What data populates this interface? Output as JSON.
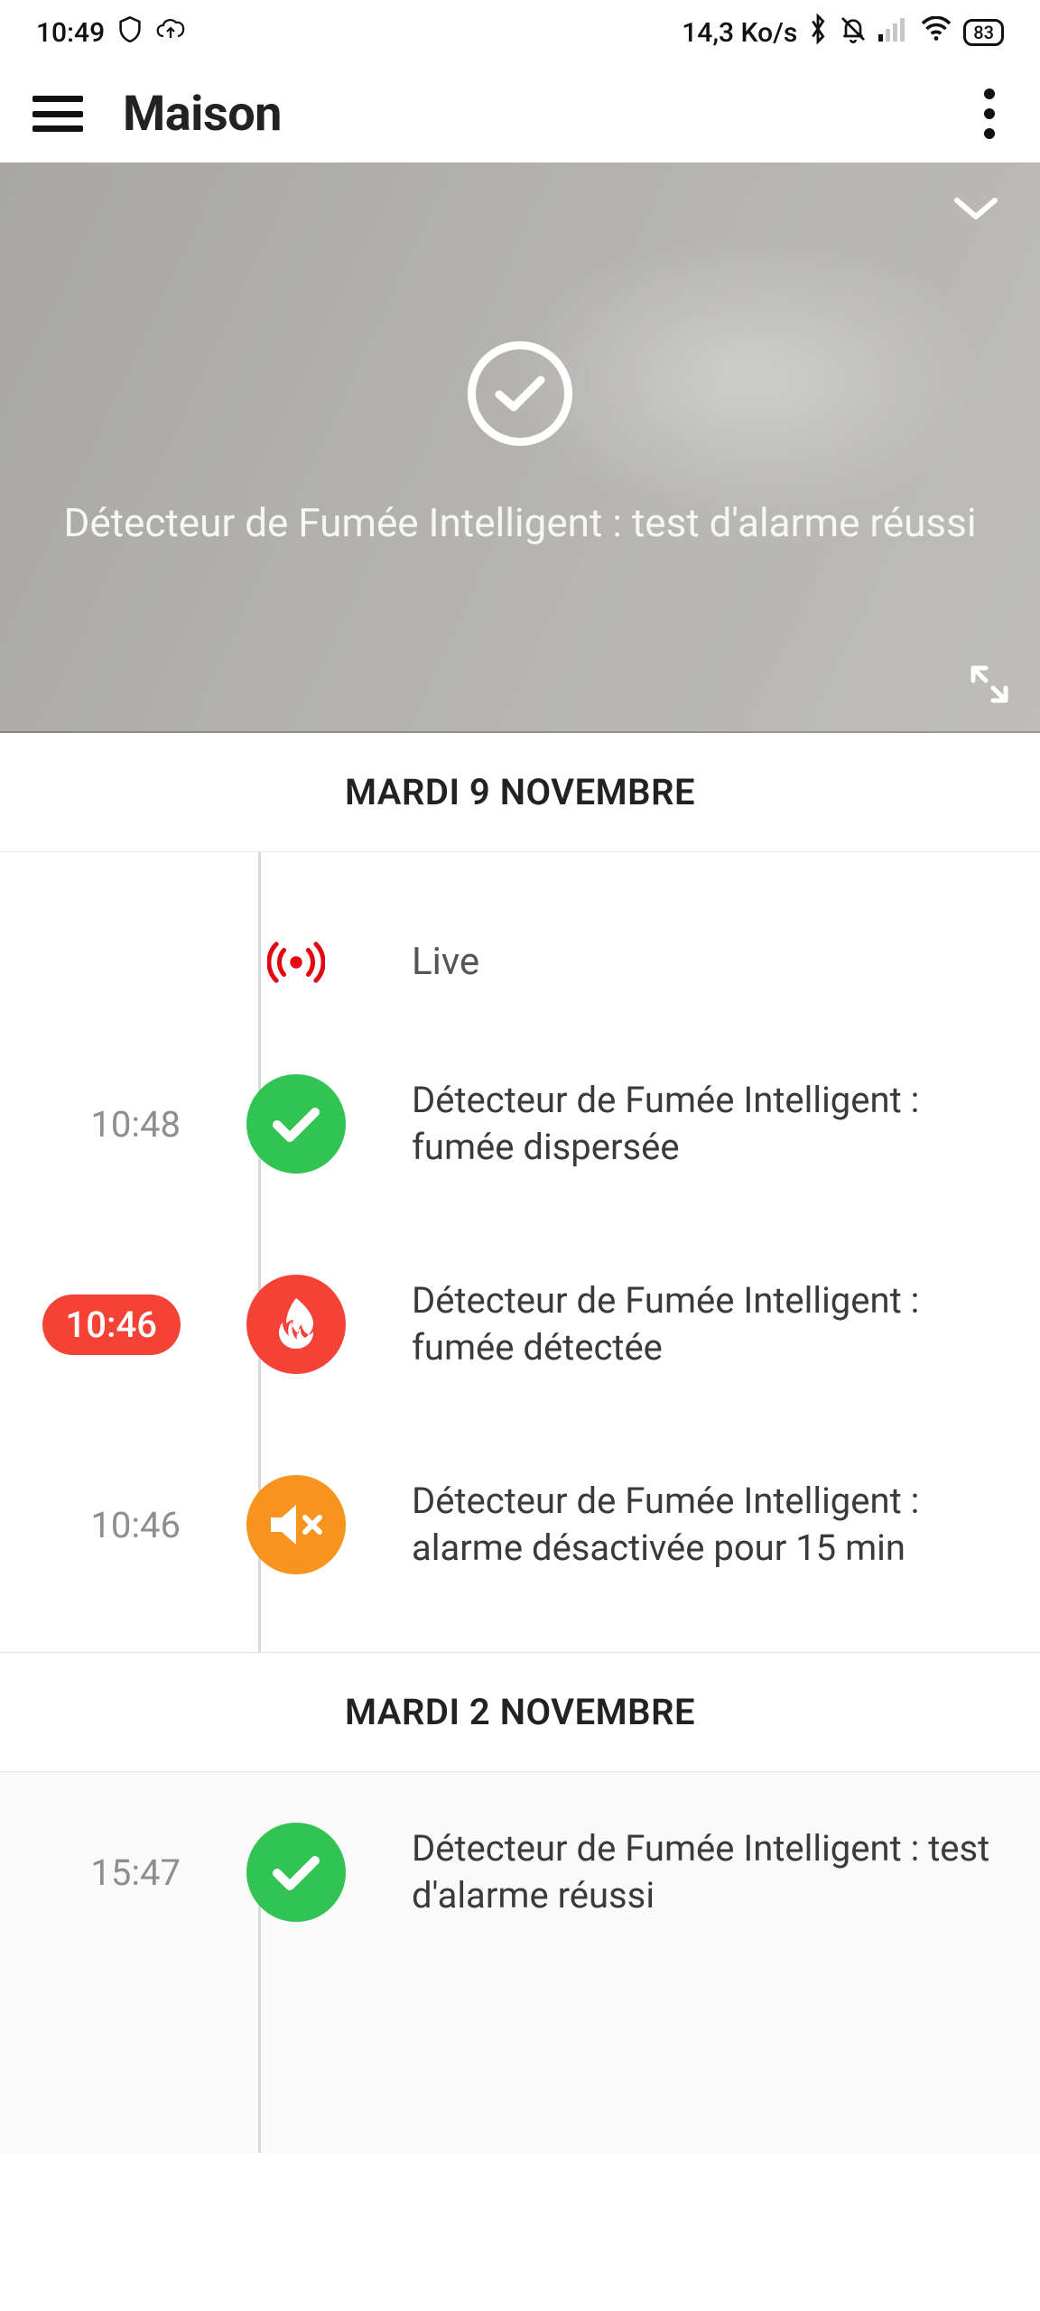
{
  "status_bar": {
    "time": "10:49",
    "data_rate": "14,3 Ko/s",
    "battery": "83"
  },
  "header": {
    "title": "Maison"
  },
  "hero": {
    "message": "Détecteur de Fumée Intelligent : test d'alarme réussi"
  },
  "sections": [
    {
      "date": "MARDI 9 NOVEMBRE",
      "items": [
        {
          "kind": "live",
          "label": "Live"
        },
        {
          "kind": "ok",
          "time": "10:48",
          "highlight": false,
          "message": "Détecteur de Fumée Intelligent : fumée dispersée"
        },
        {
          "kind": "alert",
          "time": "10:46",
          "highlight": true,
          "message": "Détecteur de Fumée Intelligent : fumée détectée"
        },
        {
          "kind": "muted",
          "time": "10:46",
          "highlight": false,
          "message": "Détecteur de Fumée Intelligent : alarme désactivée pour 15 min"
        }
      ]
    },
    {
      "date": "MARDI 2 NOVEMBRE",
      "items": [
        {
          "kind": "ok",
          "time": "15:47",
          "highlight": false,
          "message": "Détecteur de Fumée Intelligent : test d'alarme réussi"
        }
      ]
    }
  ],
  "colors": {
    "green": "#31c453",
    "red": "#f44336",
    "orange": "#f7941d"
  }
}
